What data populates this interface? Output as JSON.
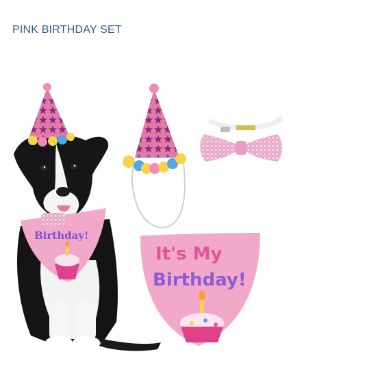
{
  "header": {
    "title": "PINK BIRTHDAY SET"
  },
  "products": {
    "dog_bandana_text": "Birthday!",
    "bandana_line1": "It's My",
    "bandana_line2": "Birthday!"
  },
  "colors": {
    "title": "#2f5a94",
    "pink": "#f2a9c9",
    "hot_pink": "#e05598",
    "star_purple": "#8a2a7a",
    "pom_yellow": "#f6d34a",
    "pom_blue": "#4fa6e8"
  }
}
